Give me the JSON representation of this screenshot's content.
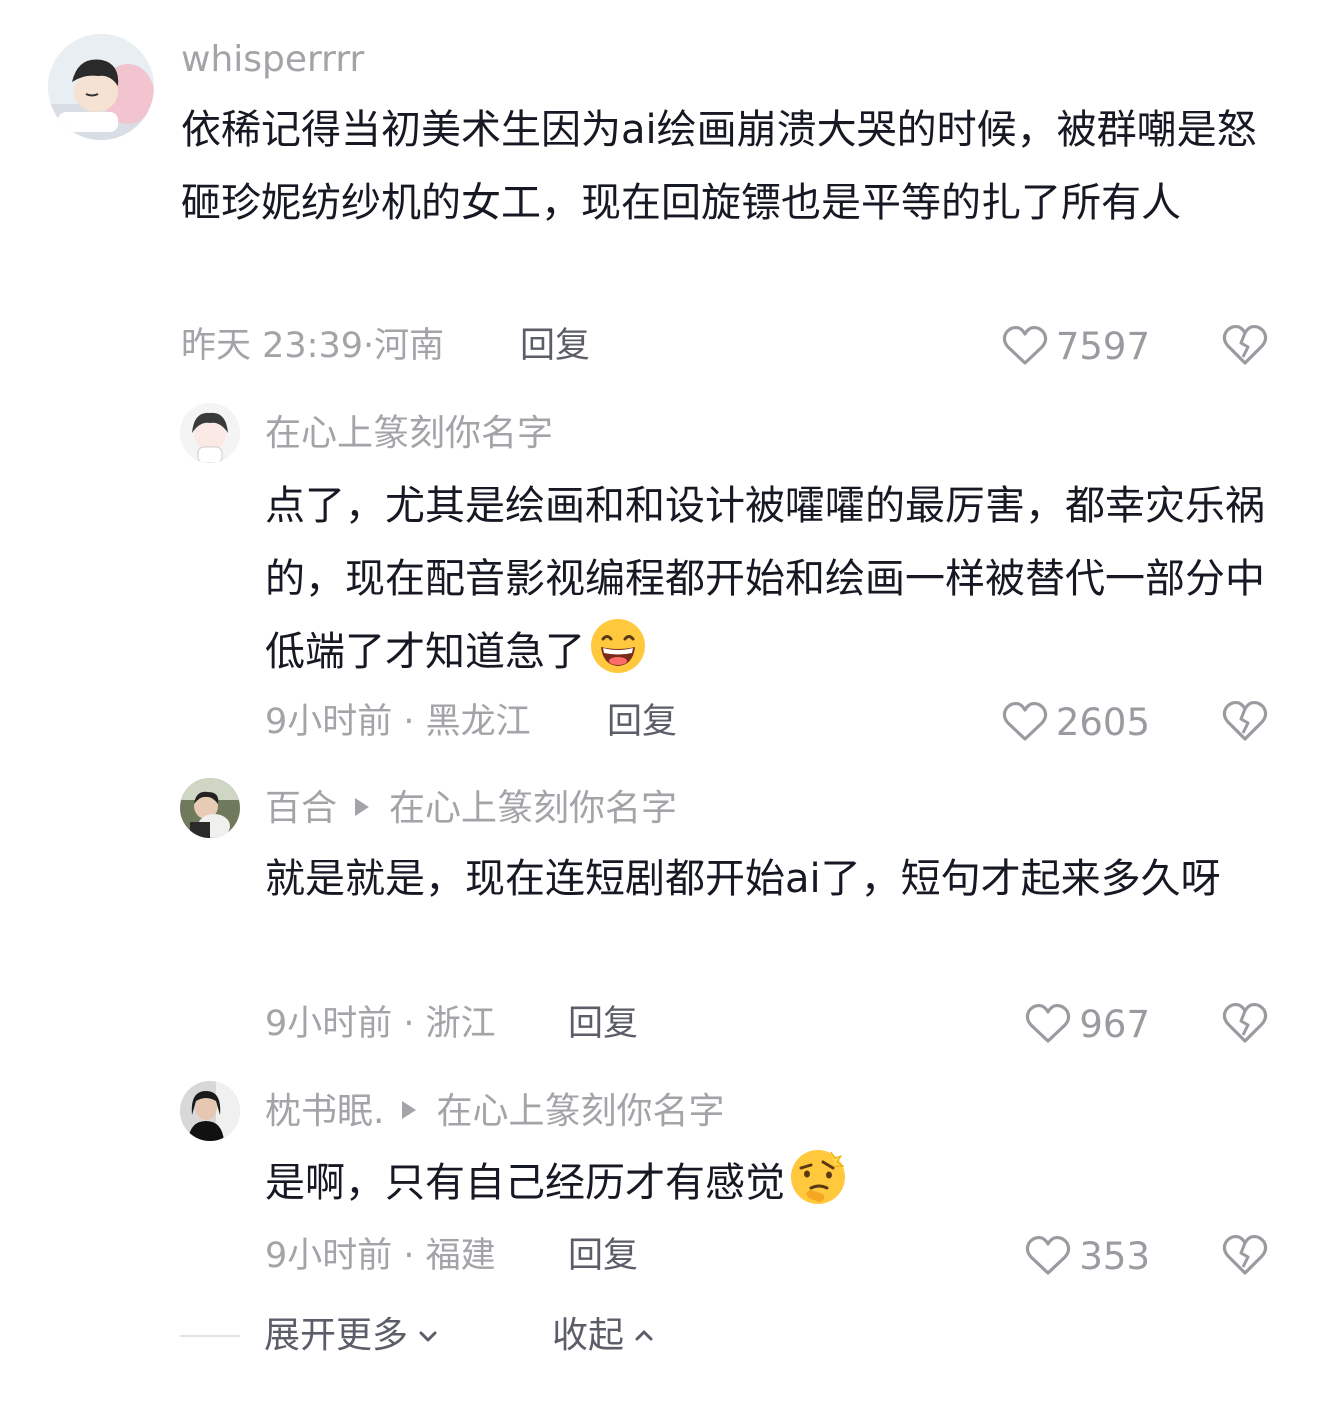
{
  "comments": [
    {
      "username": "whisperrrr",
      "reply_to": "",
      "text": "依稀记得当初美术生因为ai绘画崩溃大哭的时候，被群嘲是怒砸珍妮纺纱机的女工，现在回旋镖也是平等的扎了所有人",
      "time": "昨天 23:39",
      "location": "河南",
      "reply_label": "回复",
      "likes": "7597"
    },
    {
      "username": "在心上篆刻你名字",
      "reply_to": "",
      "text": "点了，尤其是绘画和和设计被嚯嚯的最厉害，都幸灾乐祸的，现在配音影视编程都开始和绘画一样被替代一部分中低端了才知道急了",
      "emoji": "grinning-face-emoji",
      "time": "9小时前",
      "location": "黑龙江",
      "reply_label": "回复",
      "likes": "2605"
    },
    {
      "username": "百合",
      "reply_to": "在心上篆刻你名字",
      "text": "就是就是，现在连短剧都开始ai了，短句才起来多久呀",
      "time": "9小时前",
      "location": "浙江",
      "reply_label": "回复",
      "likes": "967"
    },
    {
      "username": "枕书眠.",
      "reply_to": "在心上篆刻你名字",
      "text": "是啊，只有自己经历才有感觉",
      "emoji": "thinking-face-emoji",
      "time": "9小时前",
      "location": "福建",
      "reply_label": "回复",
      "likes": "353"
    }
  ],
  "footer": {
    "expand_label": "展开更多",
    "collapse_label": "收起"
  },
  "icons": {
    "like": "heart-outline-icon",
    "dislike": "broken-heart-icon",
    "expand": "chevron-down-icon",
    "collapse": "chevron-up-icon"
  },
  "colors": {
    "primary_text": "#161823",
    "secondary_text": "#a3a3a8",
    "reply_text": "#5b5e68"
  }
}
